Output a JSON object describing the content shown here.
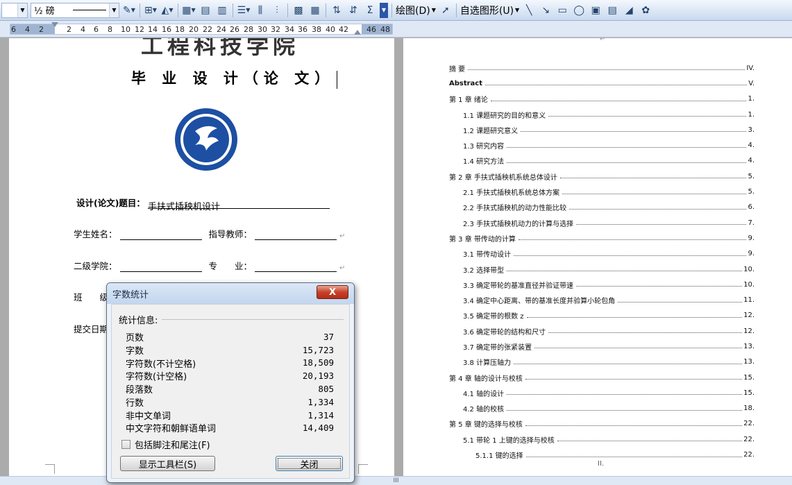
{
  "toolbar": {
    "line_weight": "½ 磅",
    "draw_label": "绘图(D)",
    "autoshape_label": "自选图形(U)"
  },
  "ruler": {
    "numbers": [
      "6",
      "4",
      "2",
      "2",
      "4",
      "6",
      "8",
      "10",
      "12",
      "14",
      "16",
      "18",
      "20",
      "22",
      "24",
      "26",
      "28",
      "30",
      "32",
      "34",
      "36",
      "38",
      "40",
      "42",
      "46",
      "48"
    ]
  },
  "page1": {
    "school_name": "工程科技学院",
    "doc_title": "毕 业 设 计（论 文）",
    "thesis_label": "设计(论文)题目：",
    "thesis_value": "手扶式插秧机设计",
    "student_label": "学生姓名：",
    "advisor_label": "指导教师：",
    "college_label": "二级学院：",
    "major_label": "专　　业：",
    "class_label": "班　　级",
    "submit_label": "提交日期"
  },
  "toc": [
    {
      "label": "摘  要",
      "page": "IV.",
      "level": 1,
      "bold": false
    },
    {
      "label": "Abstract",
      "page": "V.",
      "level": 1,
      "bold": true
    },
    {
      "label": "第 1 章  绪论",
      "page": "1.",
      "level": 1,
      "bold": false
    },
    {
      "label": "1.1 课题研究的目的和意义",
      "page": "1.",
      "level": 2,
      "bold": false
    },
    {
      "label": "1.2  课题研究意义",
      "page": "3.",
      "level": 2,
      "bold": false
    },
    {
      "label": "1.3  研究内容",
      "page": "4.",
      "level": 2,
      "bold": false
    },
    {
      "label": "1.4 研究方法",
      "page": "4.",
      "level": 2,
      "bold": false
    },
    {
      "label": "第 2 章  手扶式插秧机系统总体设计",
      "page": "5.",
      "level": 1,
      "bold": false
    },
    {
      "label": "2.1 手扶式插秧机系统总体方案",
      "page": "5.",
      "level": 2,
      "bold": false
    },
    {
      "label": "2.2  手扶式插秧机的动力性能比较",
      "page": "6.",
      "level": 2,
      "bold": false
    },
    {
      "label": "2.3  手扶式插秧机动力的计算与选择",
      "page": "7.",
      "level": 2,
      "bold": false
    },
    {
      "label": "第 3 章    带传动的计算",
      "page": "9.",
      "level": 1,
      "bold": false
    },
    {
      "label": "3.1  带传动设计",
      "page": "9.",
      "level": 2,
      "bold": false
    },
    {
      "label": "3.2 选择带型",
      "page": "10.",
      "level": 2,
      "bold": false
    },
    {
      "label": "3.3  确定带轮的基准直径并验证带速",
      "page": "10.",
      "level": 2,
      "bold": false
    },
    {
      "label": "3.4 确定中心距离、带的基准长度并验算小轮包角",
      "page": "11.",
      "level": 2,
      "bold": false
    },
    {
      "label": "3.5  确定带的根数 z",
      "page": "12.",
      "level": 2,
      "bold": false
    },
    {
      "label": "3.6  确定带轮的结构和尺寸",
      "page": "12.",
      "level": 2,
      "bold": false
    },
    {
      "label": "3.7  确定带的张紧装置",
      "page": "13.",
      "level": 2,
      "bold": false
    },
    {
      "label": "3.8 计算压轴力",
      "page": "13.",
      "level": 2,
      "bold": false
    },
    {
      "label": "第 4 章    轴的设计与校核",
      "page": "15.",
      "level": 1,
      "bold": false
    },
    {
      "label": "4.1  轴的设计",
      "page": "15.",
      "level": 2,
      "bold": false
    },
    {
      "label": "4.2  轴的校核",
      "page": "18.",
      "level": 2,
      "bold": false
    },
    {
      "label": "第 5 章   键的选择与校核",
      "page": "22.",
      "level": 1,
      "bold": false
    },
    {
      "label": "5.1  带轮 1 上键的选择与校核",
      "page": "22.",
      "level": 2,
      "bold": false
    },
    {
      "label": "5.1.1 键的选择",
      "page": "22.",
      "level": 3,
      "bold": false
    }
  ],
  "page2": {
    "footer": "II."
  },
  "dialog": {
    "title": "字数统计",
    "close_glyph": "X",
    "stats_header": "统计信息:",
    "stats": [
      {
        "label": "页数",
        "value": "37"
      },
      {
        "label": "字数",
        "value": "15,723"
      },
      {
        "label": "字符数(不计空格)",
        "value": "18,509"
      },
      {
        "label": "字符数(计空格)",
        "value": "20,193"
      },
      {
        "label": "段落数",
        "value": "805"
      },
      {
        "label": "行数",
        "value": "1,334"
      },
      {
        "label": "非中文单词",
        "value": "1,314"
      },
      {
        "label": "中文字符和朝鲜语单词",
        "value": "14,409"
      }
    ],
    "include_notes_label": "包括脚注和尾注(F)",
    "show_toolbar_label": "显示工具栏(S)",
    "close_label": "关闭"
  },
  "statusbar": {
    "grip": "III"
  },
  "colors": {
    "accent": "#1a56a8",
    "dialog_close": "#c7402b",
    "ruler_margin": "#9fb4d3"
  }
}
